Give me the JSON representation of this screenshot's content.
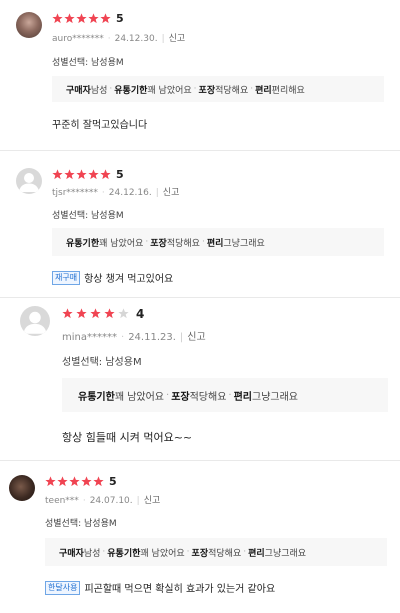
{
  "reviews": [
    {
      "rating": 5,
      "score_label": "5",
      "user": "auro*******",
      "date": "24.12.30.",
      "report": "신고",
      "option": "성별선택: 남성용M",
      "tags": [
        {
          "k": "구매자",
          "v": "남성"
        },
        {
          "k": "유통기한",
          "v": "꽤 남았어요"
        },
        {
          "k": "포장",
          "v": "적당해요"
        },
        {
          "k": "편리",
          "v": "편리해요"
        }
      ],
      "badge": "",
      "text": "꾸준히 잘먹고있습니다"
    },
    {
      "rating": 5,
      "score_label": "5",
      "user": "tjsr*******",
      "date": "24.12.16.",
      "report": "신고",
      "option": "성별선택: 남성용M",
      "tags": [
        {
          "k": "유통기한",
          "v": "꽤 남았어요"
        },
        {
          "k": "포장",
          "v": "적당해요"
        },
        {
          "k": "편리",
          "v": "그냥그래요"
        }
      ],
      "badge": "재구매",
      "text": "항상 챙겨 먹고있어요"
    },
    {
      "rating": 4,
      "score_label": "4",
      "user": "mina******",
      "date": "24.11.23.",
      "report": "신고",
      "option": "성별선택: 남성용M",
      "tags": [
        {
          "k": "유통기한",
          "v": "꽤 남았어요"
        },
        {
          "k": "포장",
          "v": "적당해요"
        },
        {
          "k": "편리",
          "v": "그냥그래요"
        }
      ],
      "badge": "",
      "text": "항상 힘들때 시켜 먹어요~~"
    },
    {
      "rating": 5,
      "score_label": "5",
      "user": "teen***",
      "date": "24.07.10.",
      "report": "신고",
      "option": "성별선택: 남성용M",
      "tags": [
        {
          "k": "구매자",
          "v": "남성"
        },
        {
          "k": "유통기한",
          "v": "꽤 남았어요"
        },
        {
          "k": "포장",
          "v": "적당해요"
        },
        {
          "k": "편리",
          "v": "그냥그래요"
        }
      ],
      "badge": "한달사용",
      "text": "피곤할때 먹으면 확실히 효과가 있는거 같아요"
    }
  ],
  "colors": {
    "star_filled": "#f04452",
    "star_empty": "#d6d6d6",
    "badge": "#1f6fd1"
  }
}
